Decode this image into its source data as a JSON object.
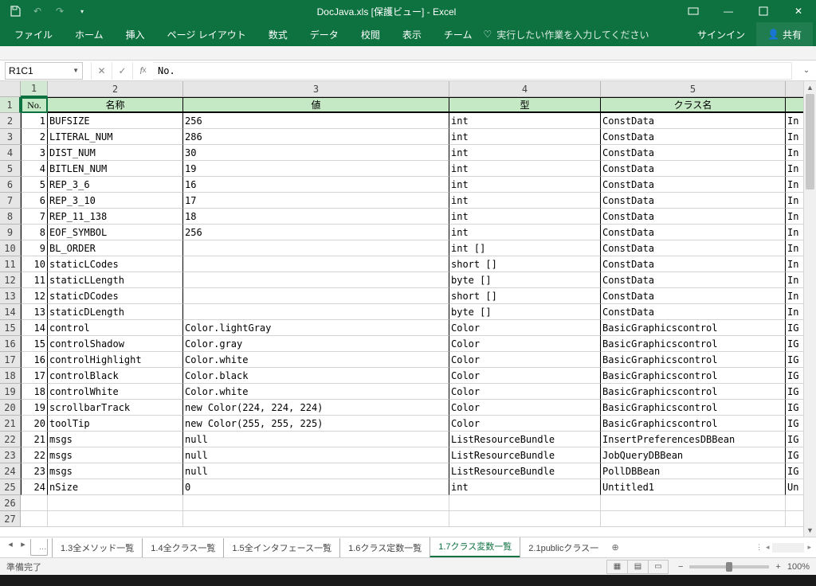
{
  "title": "DocJava.xls  [保護ビュー] - Excel",
  "signin": "サインイン",
  "share": "共有",
  "tabs": [
    "ファイル",
    "ホーム",
    "挿入",
    "ページ レイアウト",
    "数式",
    "データ",
    "校閲",
    "表示",
    "チーム"
  ],
  "tell": "実行したい作業を入力してください",
  "namebox": "R1C1",
  "fx_value": "No.",
  "colhdrs": [
    "1",
    "2",
    "3",
    "4",
    "5"
  ],
  "rowhdrs": [
    "1",
    "2",
    "3",
    "4",
    "5",
    "6",
    "7",
    "8",
    "9",
    "10",
    "11",
    "12",
    "13",
    "14",
    "15",
    "16",
    "17",
    "18",
    "19",
    "20",
    "21",
    "22",
    "23",
    "24",
    "25",
    "26",
    "27"
  ],
  "table_headers": [
    "No.",
    "名称",
    "値",
    "型",
    "クラス名"
  ],
  "rows": [
    {
      "no": "1",
      "name": "BUFSIZE",
      "val": "256",
      "type": "int",
      "cls": "ConstData",
      "f": "In"
    },
    {
      "no": "2",
      "name": "LITERAL_NUM",
      "val": "286",
      "type": "int",
      "cls": "ConstData",
      "f": "In"
    },
    {
      "no": "3",
      "name": "DIST_NUM",
      "val": "30",
      "type": "int",
      "cls": "ConstData",
      "f": "In"
    },
    {
      "no": "4",
      "name": "BITLEN_NUM",
      "val": "19",
      "type": "int",
      "cls": "ConstData",
      "f": "In"
    },
    {
      "no": "5",
      "name": "REP_3_6",
      "val": "16",
      "type": "int",
      "cls": "ConstData",
      "f": "In"
    },
    {
      "no": "6",
      "name": "REP_3_10",
      "val": "17",
      "type": "int",
      "cls": "ConstData",
      "f": "In"
    },
    {
      "no": "7",
      "name": "REP_11_138",
      "val": "18",
      "type": "int",
      "cls": "ConstData",
      "f": "In"
    },
    {
      "no": "8",
      "name": "EOF_SYMBOL",
      "val": "256",
      "type": "int",
      "cls": "ConstData",
      "f": "In"
    },
    {
      "no": "9",
      "name": "BL_ORDER",
      "val": "",
      "type": "int []",
      "cls": "ConstData",
      "f": "In"
    },
    {
      "no": "10",
      "name": "staticLCodes",
      "val": "",
      "type": "short []",
      "cls": "ConstData",
      "f": "In"
    },
    {
      "no": "11",
      "name": "staticLLength",
      "val": "",
      "type": "byte []",
      "cls": "ConstData",
      "f": "In"
    },
    {
      "no": "12",
      "name": "staticDCodes",
      "val": "",
      "type": "short []",
      "cls": "ConstData",
      "f": "In"
    },
    {
      "no": "13",
      "name": "staticDLength",
      "val": "",
      "type": "byte []",
      "cls": "ConstData",
      "f": "In"
    },
    {
      "no": "14",
      "name": "control",
      "val": "Color.lightGray",
      "type": "Color",
      "cls": "BasicGraphicscontrol",
      "f": "IG"
    },
    {
      "no": "15",
      "name": "controlShadow",
      "val": "Color.gray",
      "type": "Color",
      "cls": "BasicGraphicscontrol",
      "f": "IG"
    },
    {
      "no": "16",
      "name": "controlHighlight",
      "val": "Color.white",
      "type": "Color",
      "cls": "BasicGraphicscontrol",
      "f": "IG"
    },
    {
      "no": "17",
      "name": "controlBlack",
      "val": "Color.black",
      "type": "Color",
      "cls": "BasicGraphicscontrol",
      "f": "IG"
    },
    {
      "no": "18",
      "name": "controlWhite",
      "val": "Color.white",
      "type": "Color",
      "cls": "BasicGraphicscontrol",
      "f": "IG"
    },
    {
      "no": "19",
      "name": "scrollbarTrack",
      "val": "new Color(224, 224, 224)",
      "type": "Color",
      "cls": "BasicGraphicscontrol",
      "f": "IG"
    },
    {
      "no": "20",
      "name": "toolTip",
      "val": "new Color(255, 255, 225)",
      "type": "Color",
      "cls": "BasicGraphicscontrol",
      "f": "IG"
    },
    {
      "no": "21",
      "name": "msgs",
      "val": "null",
      "type": "ListResourceBundle",
      "cls": "InsertPreferencesDBBean",
      "f": "IG"
    },
    {
      "no": "22",
      "name": "msgs",
      "val": "null",
      "type": "ListResourceBundle",
      "cls": "JobQueryDBBean",
      "f": "IG"
    },
    {
      "no": "23",
      "name": "msgs",
      "val": "null",
      "type": "ListResourceBundle",
      "cls": "PollDBBean",
      "f": "IG"
    },
    {
      "no": "24",
      "name": "nSize",
      "val": "0",
      "type": "int",
      "cls": "Untitled1",
      "f": "Un"
    }
  ],
  "sheet_tabs": [
    "1.3全メソッド一覧",
    "1.4全クラス一覧",
    "1.5全インタフェース一覧",
    "1.6クラス定数一覧",
    "1.7クラス変数一覧",
    "2.1publicクラス一"
  ],
  "active_sheet": 4,
  "status": "準備完了",
  "zoom": "100%"
}
